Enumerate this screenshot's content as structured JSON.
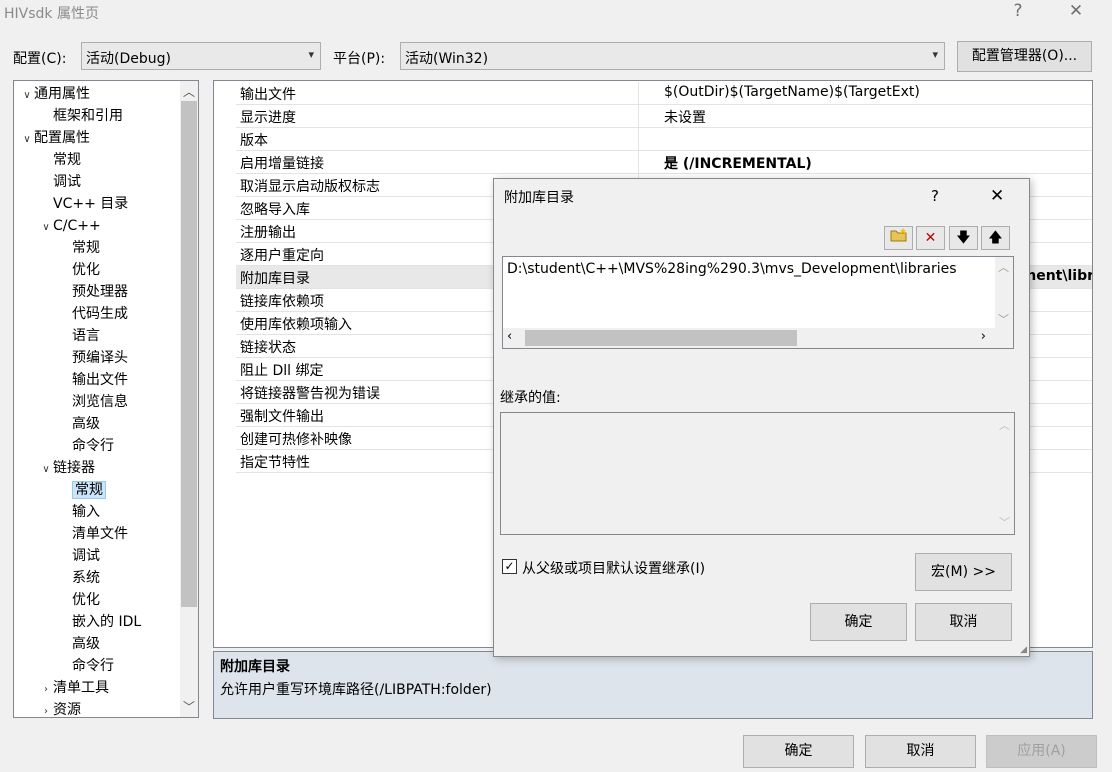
{
  "window": {
    "title": "HIVsdk 属性页",
    "help": "?",
    "close": "✕"
  },
  "config": {
    "label": "配置(C):",
    "value": "活动(Debug)"
  },
  "platform": {
    "label": "平台(P):",
    "value": "活动(Win32)"
  },
  "config_manager": "配置管理器(O)...",
  "tree": {
    "items": [
      {
        "label": "通用属性",
        "chev": "∨"
      },
      {
        "label": "框架和引用",
        "chev": ""
      },
      {
        "label": "配置属性",
        "chev": "∨"
      },
      {
        "label": "常规",
        "chev": ""
      },
      {
        "label": "调试",
        "chev": ""
      },
      {
        "label": "VC++ 目录",
        "chev": ""
      },
      {
        "label": "C/C++",
        "chev": "∨"
      },
      {
        "label": "常规",
        "chev": ""
      },
      {
        "label": "优化",
        "chev": ""
      },
      {
        "label": "预处理器",
        "chev": ""
      },
      {
        "label": "代码生成",
        "chev": ""
      },
      {
        "label": "语言",
        "chev": ""
      },
      {
        "label": "预编译头",
        "chev": ""
      },
      {
        "label": "输出文件",
        "chev": ""
      },
      {
        "label": "浏览信息",
        "chev": ""
      },
      {
        "label": "高级",
        "chev": ""
      },
      {
        "label": "命令行",
        "chev": ""
      },
      {
        "label": "链接器",
        "chev": "∨"
      },
      {
        "label": "常规",
        "chev": ""
      },
      {
        "label": "输入",
        "chev": ""
      },
      {
        "label": "清单文件",
        "chev": ""
      },
      {
        "label": "调试",
        "chev": ""
      },
      {
        "label": "系统",
        "chev": ""
      },
      {
        "label": "优化",
        "chev": ""
      },
      {
        "label": "嵌入的 IDL",
        "chev": ""
      },
      {
        "label": "高级",
        "chev": ""
      },
      {
        "label": "命令行",
        "chev": ""
      },
      {
        "label": "清单工具",
        "chev": "›"
      },
      {
        "label": "资源",
        "chev": "›"
      }
    ],
    "selected_index": 18
  },
  "grid": {
    "rows": [
      {
        "name": "输出文件",
        "value": "$(OutDir)$(TargetName)$(TargetExt)"
      },
      {
        "name": "显示进度",
        "value": "未设置"
      },
      {
        "name": "版本",
        "value": ""
      },
      {
        "name": "启用增量链接",
        "value": "是 (/INCREMENTAL)"
      },
      {
        "name": "取消显示启动版权标志",
        "value": ""
      },
      {
        "name": "忽略导入库",
        "value": ""
      },
      {
        "name": "注册输出",
        "value": ""
      },
      {
        "name": "逐用户重定向",
        "value": ""
      },
      {
        "name": "附加库目录",
        "value": "nent\\libr"
      },
      {
        "name": "链接库依赖项",
        "value": ""
      },
      {
        "name": "使用库依赖项输入",
        "value": ""
      },
      {
        "name": "链接状态",
        "value": ""
      },
      {
        "name": "阻止 Dll 绑定",
        "value": ""
      },
      {
        "name": "将链接器警告视为错误",
        "value": ""
      },
      {
        "name": "强制文件输出",
        "value": ""
      },
      {
        "name": "创建可热修补映像",
        "value": ""
      },
      {
        "name": "指定节特性",
        "value": ""
      }
    ]
  },
  "description": {
    "title": "附加库目录",
    "text": "允许用户重写环境库路径(/LIBPATH:folder)"
  },
  "dialog": {
    "title": "附加库目录",
    "help": "?",
    "close": "✕",
    "path": "D:\\student\\C++\\MVS%28ing%290.3\\mvs_Development\\libraries",
    "inherited_label": "继承的值:",
    "inherit_checkbox": "从父级或项目默认设置继承(I)",
    "macro_button": "宏(M) >>",
    "ok": "确定",
    "cancel": "取消"
  },
  "footer": {
    "ok": "确定",
    "cancel": "取消",
    "apply": "应用(A)"
  },
  "colors": {
    "accent": "#cce4f7",
    "desc_bg": "#dde4ec",
    "delete_red": "#c00000"
  }
}
